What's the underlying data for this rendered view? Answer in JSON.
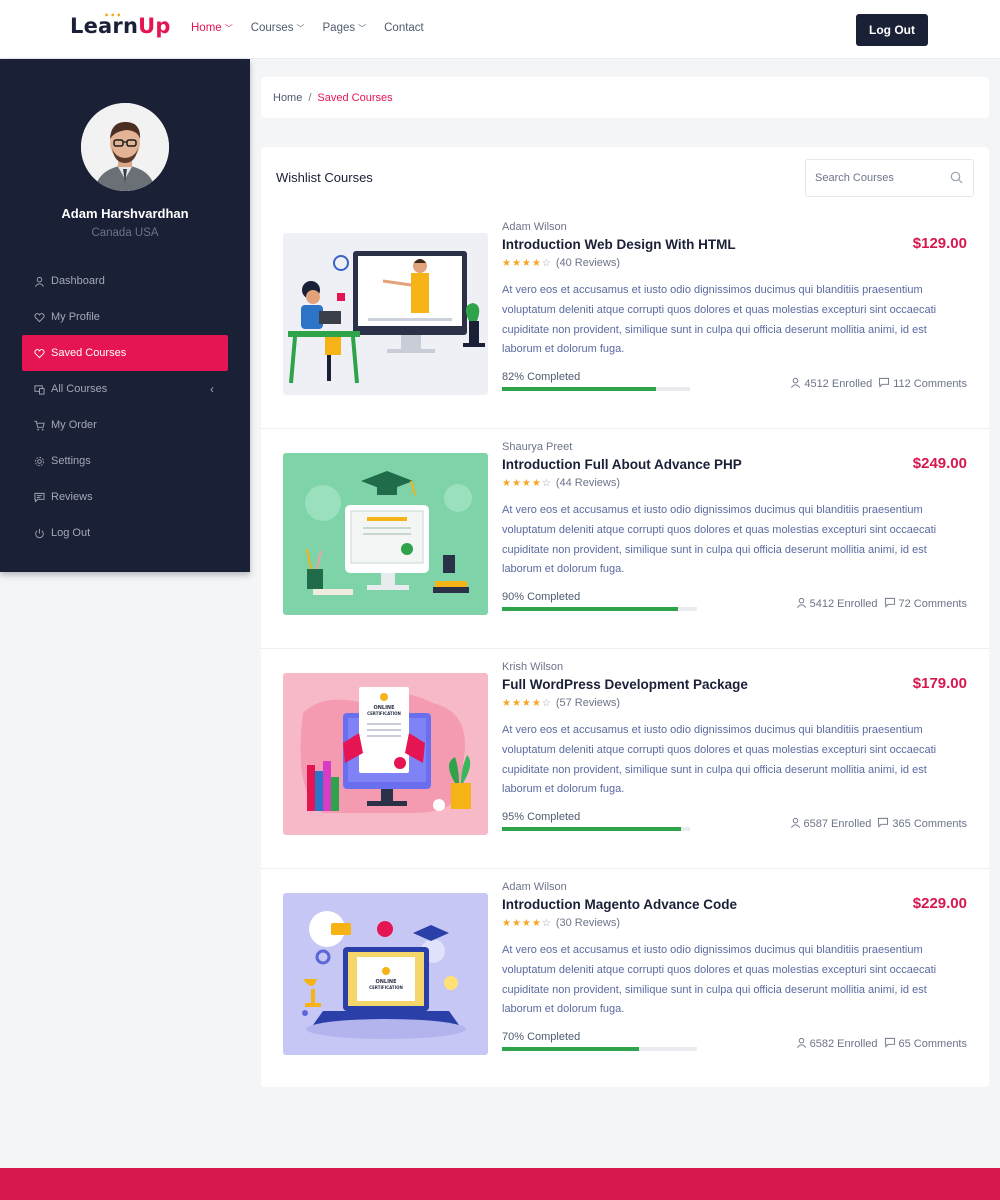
{
  "header": {
    "logo_a": "Learn",
    "logo_b": "Up",
    "nav": [
      {
        "label": "Home",
        "active": true,
        "has_dropdown": true
      },
      {
        "label": "Courses",
        "active": false,
        "has_dropdown": true
      },
      {
        "label": "Pages",
        "active": false,
        "has_dropdown": true
      },
      {
        "label": "Contact",
        "active": false,
        "has_dropdown": false
      }
    ],
    "logout_label": "Log Out"
  },
  "sidebar": {
    "user_name": "Adam Harshvardhan",
    "user_location": "Canada USA",
    "items": [
      {
        "label": "Dashboard",
        "icon": "user-icon"
      },
      {
        "label": "My Profile",
        "icon": "heart-icon"
      },
      {
        "label": "Saved Courses",
        "icon": "heart-icon",
        "active": true
      },
      {
        "label": "All Courses",
        "icon": "monitor-icon",
        "has_arrow": true
      },
      {
        "label": "My Order",
        "icon": "cart-icon"
      },
      {
        "label": "Settings",
        "icon": "gear-icon"
      },
      {
        "label": "Reviews",
        "icon": "comment-icon"
      },
      {
        "label": "Log Out",
        "icon": "power-icon"
      }
    ]
  },
  "breadcrumb": {
    "home": "Home",
    "separator": "/",
    "current": "Saved Courses"
  },
  "main": {
    "title": "Wishlist Courses",
    "search_placeholder": "Search Courses",
    "courses": [
      {
        "author": "Adam Wilson",
        "title": "Introduction Web Design With HTML",
        "price": "$129.00",
        "stars": "★★★★",
        "star_empty": "☆",
        "reviews": "(40 Reviews)",
        "description": "At vero eos et accusamus et iusto odio dignissimos ducimus qui blanditiis praesentium voluptatum deleniti atque corrupti quos dolores et quas molestias excepturi sint occaecati cupiditate non provident, similique sunt in culpa qui officia deserunt mollitia animi, id est laborum et dolorum fuga.",
        "progress_label": "82% Completed",
        "progress": 0.82,
        "enrolled": "4512 Enrolled",
        "comments": "112 Comments",
        "illustration": "online-class-illustration"
      },
      {
        "author": "Shaurya Preet",
        "title": "Introduction Full About Advance PHP",
        "price": "$249.00",
        "stars": "★★★★",
        "star_empty": "☆",
        "reviews": "(44 Reviews)",
        "description": "At vero eos et accusamus et iusto odio dignissimos ducimus qui blanditiis praesentium voluptatum deleniti atque corrupti quos dolores et quas molestias excepturi sint occaecati cupiditate non provident, similique sunt in culpa qui officia deserunt mollitia animi, id est laborum et dolorum fuga.",
        "progress_label": "90% Completed",
        "progress": 0.9,
        "enrolled": "5412 Enrolled",
        "comments": "72 Comments",
        "illustration": "certificate-illustration"
      },
      {
        "author": "Krish Wilson",
        "title": "Full WordPress Development Package",
        "price": "$179.00",
        "stars": "★★★★",
        "star_empty": "☆",
        "reviews": "(57 Reviews)",
        "description": "At vero eos et accusamus et iusto odio dignissimos ducimus qui blanditiis praesentium voluptatum deleniti atque corrupti quos dolores et quas molestias excepturi sint occaecati cupiditate non provident, similique sunt in culpa qui officia deserunt mollitia animi, id est laborum et dolorum fuga.",
        "progress_label": "95% Completed",
        "progress": 0.95,
        "enrolled": "6587 Enrolled",
        "comments": "365 Comments",
        "illustration": "online-certification-illustration",
        "illustration_text_a": "ONLINE",
        "illustration_text_b": "CERTIFICATION"
      },
      {
        "author": "Adam Wilson",
        "title": "Introduction Magento Advance Code",
        "price": "$229.00",
        "stars": "★★★★",
        "star_empty": "☆",
        "reviews": "(30 Reviews)",
        "description": "At vero eos et accusamus et iusto odio dignissimos ducimus qui blanditiis praesentium voluptatum deleniti atque corrupti quos dolores et quas molestias excepturi sint occaecati cupiditate non provident, similique sunt in culpa qui officia deserunt mollitia animi, id est laborum et dolorum fuga.",
        "progress_label": "70% Completed",
        "progress": 0.7,
        "enrolled": "6582 Enrolled",
        "comments": "65 Comments",
        "illustration": "laptop-certification-illustration",
        "illustration_text_a": "ONLINE",
        "illustration_text_b": "CERTIFICATION"
      }
    ]
  },
  "colors": {
    "accent": "#e51553",
    "price": "#d7184f",
    "dark": "#1a2035",
    "progress": "#2ea34a"
  }
}
